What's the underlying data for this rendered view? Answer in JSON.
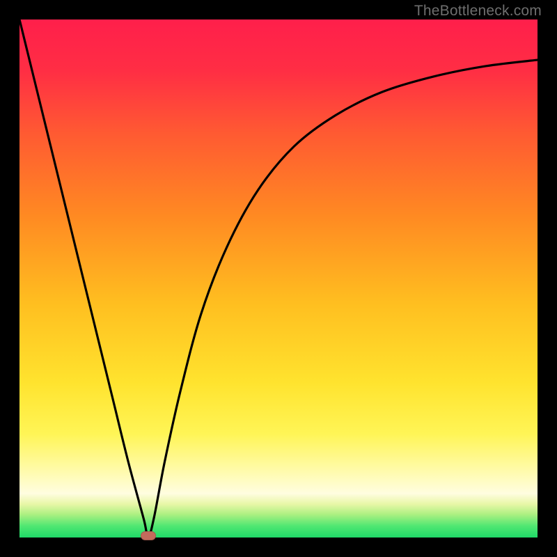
{
  "watermark": {
    "text": "TheBottleneck.com"
  },
  "colors": {
    "frame_bg": "#000000",
    "gradient_top": "#ff1f4b",
    "gradient_mid1": "#ff6a2a",
    "gradient_mid2": "#ffae22",
    "gradient_mid3": "#ffe636",
    "gradient_band": "#fffbb0",
    "gradient_green": "#2fe06b",
    "curve": "#000000",
    "marker": "#c46a5c"
  },
  "chart_data": {
    "type": "line",
    "title": "",
    "xlabel": "",
    "ylabel": "",
    "x": [
      0.0,
      0.03,
      0.06,
      0.09,
      0.12,
      0.15,
      0.18,
      0.21,
      0.24,
      0.2485,
      0.26,
      0.28,
      0.31,
      0.35,
      0.4,
      0.46,
      0.53,
      0.61,
      0.7,
      0.8,
      0.9,
      1.0
    ],
    "values": [
      1.0,
      0.878,
      0.756,
      0.634,
      0.512,
      0.39,
      0.268,
      0.146,
      0.035,
      0.0,
      0.04,
      0.145,
      0.28,
      0.43,
      0.56,
      0.67,
      0.755,
      0.815,
      0.86,
      0.89,
      0.91,
      0.922
    ],
    "xlim": [
      0,
      1
    ],
    "ylim": [
      0,
      1
    ],
    "marker": {
      "x": 0.2485,
      "y": 0.0
    },
    "annotations": []
  }
}
